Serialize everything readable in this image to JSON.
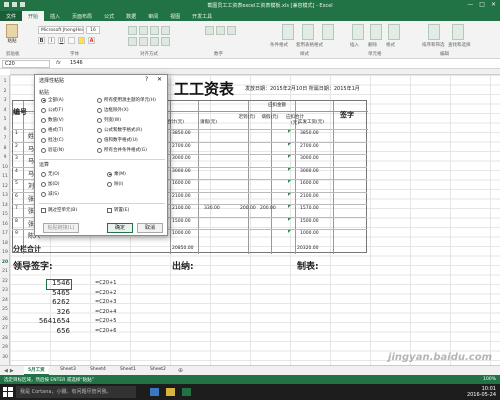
{
  "titlebar": {
    "title": "截图员工工资表excel工资表模板.xls [兼容模式] - Excel",
    "min": "—",
    "max": "□",
    "close": "✕"
  },
  "ribbon_tabs": [
    "文件",
    "开始",
    "插入",
    "页面布局",
    "公式",
    "数据",
    "审阅",
    "视图",
    "开发工具"
  ],
  "ribbon": {
    "paste": "粘贴",
    "font_name": "Microsoft JhengHei UI L",
    "font_size": "16",
    "bold": "B",
    "italic": "I",
    "underline": "U",
    "groups": [
      "剪贴板",
      "字体",
      "对齐方式",
      "数字",
      "样式",
      "单元格",
      "编辑"
    ],
    "cond_format": "条件格式",
    "table_fmt": "套用表格格式",
    "cell_style": "单元格样式",
    "insert": "插入",
    "delete": "删除",
    "format": "格式",
    "sort": "排序和筛选",
    "find": "查找和选择"
  },
  "formula_bar": {
    "cell_ref": "C20",
    "fx": "fx",
    "value": "1546"
  },
  "sheet": {
    "title": "工工资表",
    "meta": "发放日期：2015年2月10日  所属日期：2015年1月",
    "col_num": "编号",
    "col_name": "姓名",
    "signature": "签字",
    "should_deduct": "应扣金额",
    "actual_salary": "实发工资(元)",
    "sub_total_col": "合计(元)",
    "late": "迟到(元)",
    "absent": "请假(元)",
    "sick": "病假(元)",
    "deduct_total": "应扣合计(元)",
    "rows": [
      {
        "id": "1",
        "name": "姓名",
        "base": "3850.00",
        "leave": "",
        "late": "",
        "absent": "",
        "deduct": "",
        "actual": "3850.00"
      },
      {
        "id": "2",
        "name": "马兰",
        "base": "2700.00",
        "leave": "",
        "late": "",
        "absent": "",
        "deduct": "",
        "actual": "2700.00"
      },
      {
        "id": "3",
        "name": "马华",
        "base": "3000.00",
        "leave": "",
        "late": "",
        "absent": "",
        "deduct": "",
        "actual": "3000.00"
      },
      {
        "id": "4",
        "name": "马宝",
        "base": "3000.00",
        "leave": "",
        "late": "",
        "absent": "",
        "deduct": "",
        "actual": "3000.00"
      },
      {
        "id": "5",
        "name": "刘七",
        "base": "1600.00",
        "leave": "",
        "late": "",
        "absent": "",
        "deduct": "",
        "actual": "1600.00"
      },
      {
        "id": "6",
        "name": "张三",
        "base": "2100.00",
        "leave": "",
        "late": "",
        "absent": "",
        "deduct": "",
        "actual": "2100.00"
      },
      {
        "id": "7",
        "name": "张四",
        "base": "2100.00",
        "leave": "330.00",
        "late": "200.00",
        "absent": "200.00",
        "deduct": "",
        "actual": "1570.00"
      },
      {
        "id": "8",
        "name": "张五",
        "base": "1500.00",
        "leave": "",
        "late": "",
        "absent": "",
        "deduct": "",
        "actual": "1500.00"
      },
      {
        "id": "9",
        "name": "陈六",
        "base": "1000.00",
        "leave": "",
        "late": "",
        "absent": "",
        "deduct": "",
        "actual": "1000.00"
      }
    ],
    "subtotal_label": "分栏合计",
    "subtotal_base": "20850.00",
    "subtotal_actual": "20320.00",
    "sign_leader": "领导签字:",
    "sign_cashier": "出纳:",
    "sign_maker": "制表:",
    "calc": [
      {
        "row": "20",
        "num": "1546",
        "f": "=C20+1"
      },
      {
        "row": "21",
        "num": "5465",
        "f": "=C20+2"
      },
      {
        "row": "22",
        "num": "6262",
        "f": "=C20+3"
      },
      {
        "row": "23",
        "num": "326",
        "f": "=C20+4"
      },
      {
        "row": "24",
        "num": "5641654",
        "f": "=C20+5"
      },
      {
        "row": "25",
        "num": "656",
        "f": "=C20+6"
      }
    ],
    "row_numbers": [
      "1",
      "2",
      "3",
      "4",
      "5",
      "6",
      "7",
      "8",
      "9",
      "10",
      "11",
      "12",
      "13",
      "14",
      "15",
      "16",
      "17",
      "18",
      "19",
      "20",
      "21",
      "22",
      "23",
      "24",
      "25",
      "26",
      "27",
      "28",
      "29",
      "30"
    ]
  },
  "dialog": {
    "title": "选择性粘贴",
    "help": "?",
    "close": "✕",
    "paste_section": "粘贴",
    "paste_left": [
      "全部(A)",
      "公式(F)",
      "数值(V)",
      "格式(T)",
      "批注(C)",
      "验证(N)"
    ],
    "paste_right": [
      "所有使用源主题的单元(H)",
      "边框除外(X)",
      "列宽(W)",
      "公式和数字格式(R)",
      "值和数字格式(U)",
      "所有合并条件格式(G)"
    ],
    "op_section": "运算",
    "op_left": [
      "无(O)",
      "加(D)",
      "减(S)"
    ],
    "op_right": [
      "乘(M)",
      "除(I)"
    ],
    "skip_blanks": "跳过空单元(B)",
    "transpose": "转置(E)",
    "paste_link": "粘贴链接(L)",
    "ok": "确定",
    "cancel": "取消"
  },
  "sheet_tabs": [
    "5月工资",
    "Sheet3",
    "Sheet4",
    "Sheet1",
    "Sheet2"
  ],
  "statusbar": {
    "text": "选定目标区域，然后按 ENTER 或选择“粘贴”",
    "zoom": "100%"
  },
  "taskbar": {
    "search": "我是 Cortana，小娜。有问题尽管问我。",
    "time": "10:01",
    "date": "2016-05-24"
  },
  "watermark": "jingyan.baidu.com"
}
